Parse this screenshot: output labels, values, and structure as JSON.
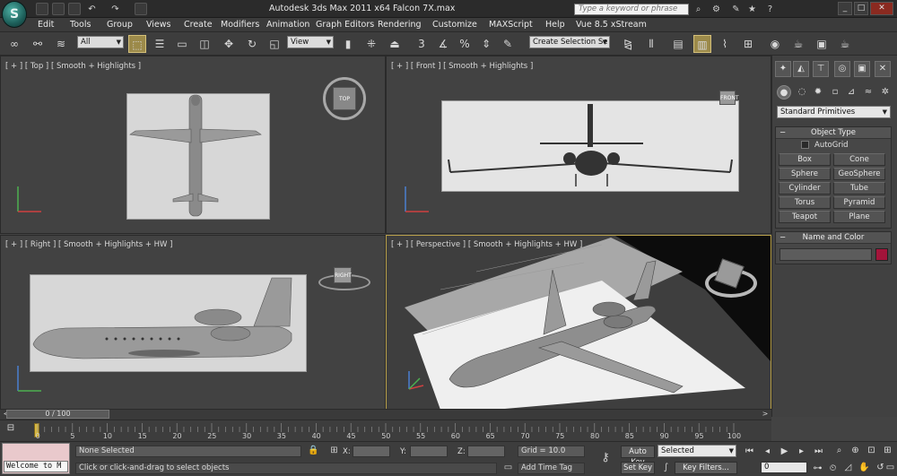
{
  "titlebar": {
    "title": "Autodesk 3ds Max  2011 x64      Falcon 7X.max",
    "search_placeholder": "Type a keyword or phrase"
  },
  "menu": [
    "Edit",
    "Tools",
    "Group",
    "Views",
    "Create",
    "Modifiers",
    "Animation",
    "Graph Editors",
    "Rendering",
    "Customize",
    "MAXScript",
    "Help",
    "Vue 8.5 xStream"
  ],
  "toolbar": {
    "filter_value": "All",
    "refcoord_value": "View",
    "selection_set_value": "Create Selection Se"
  },
  "viewports": {
    "top": "[ + ] [ Top ] [ Smooth + Highlights ]",
    "front": "[ + ] [ Front ] [ Smooth + Highlights ]",
    "right": "[ + ] [ Right ] [ Smooth + Highlights + HW ]",
    "perspective": "[ + ] [ Perspective ] [ Smooth + Highlights + HW ]",
    "gizmo_top": "TOP",
    "gizmo_front": "FRONT",
    "gizmo_right": "RIGHT"
  },
  "command_panel": {
    "category_value": "Standard Primitives",
    "object_type_title": "Object Type",
    "autogrid_label": "AutoGrid",
    "primitives": [
      "Box",
      "Cone",
      "Sphere",
      "GeoSphere",
      "Cylinder",
      "Tube",
      "Torus",
      "Pyramid",
      "Teapot",
      "Plane"
    ],
    "name_color_title": "Name and Color",
    "object_color": "#a3143a"
  },
  "timeline": {
    "slider_label": "0 / 100",
    "ticks": [
      "0",
      "5",
      "10",
      "15",
      "20",
      "25",
      "30",
      "35",
      "40",
      "45",
      "50",
      "55",
      "60",
      "65",
      "70",
      "75",
      "80",
      "85",
      "90",
      "95",
      "100"
    ]
  },
  "status": {
    "maxscript_text": "Welcome to M",
    "selection_status": "None Selected",
    "prompt": "Click or click-and-drag to select objects",
    "x_label": "X:",
    "y_label": "Y:",
    "z_label": "Z:",
    "grid": "Grid = 10.0",
    "add_time_tag": "Add Time Tag",
    "auto_key": "Auto Key",
    "set_key": "Set Key",
    "selected_value": "Selected",
    "key_filters": "Key Filters...",
    "frame_value": "0"
  }
}
